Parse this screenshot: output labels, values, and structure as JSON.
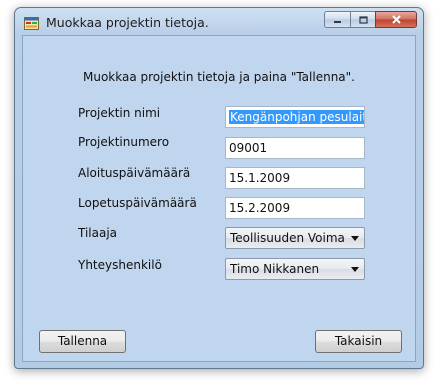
{
  "window": {
    "title": "Muokkaa projektin tietoja."
  },
  "form": {
    "instruction": "Muokkaa projektin tietoja ja paina \"Tallenna\".",
    "project_name_label": "Projektin nimi",
    "project_name_value": "Kengänpohjan pesulaite",
    "project_number_label": "Projektinumero",
    "project_number_value": "09001",
    "start_date_label": "Aloituspäivämäärä",
    "start_date_value": "15.1.2009",
    "end_date_label": "Lopetuspäivämäärä",
    "end_date_value": "15.2.2009",
    "client_label": "Tilaaja",
    "client_value": "Teollisuuden Voima Oyj",
    "contact_label": "Yhteyshenkilö",
    "contact_value": "Timo Nikkanen"
  },
  "buttons": {
    "save_label": "Tallenna",
    "back_label": "Takaisin"
  },
  "icons": {
    "app": "form-window-icon",
    "minimize": "minimize-icon",
    "maximize": "maximize-icon",
    "close": "close-icon",
    "dropdown": "chevron-down-icon"
  },
  "colors": {
    "client_background": "#c0d5ee",
    "selection": "#3399ff"
  }
}
